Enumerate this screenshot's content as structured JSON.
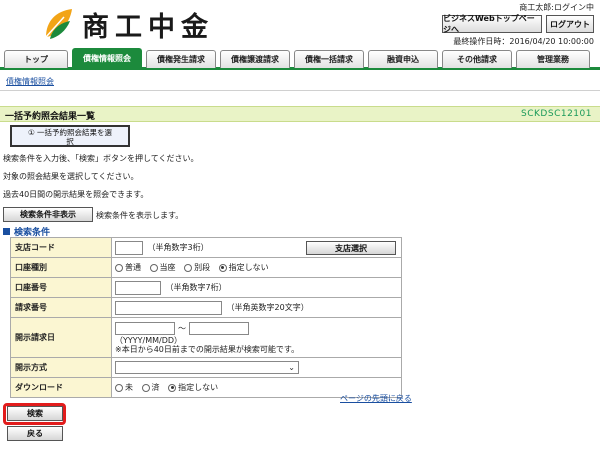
{
  "header": {
    "bank_name": "商工中金",
    "user_status": "商工太郎:ログイン中",
    "web_top_button": "ビジネスWebトップページへ",
    "logout_button": "ログアウト",
    "last_operation": "最終操作日時：2016/04/20 10:00:00"
  },
  "tabs": [
    {
      "label": "トップ"
    },
    {
      "label": "債権情報照会"
    },
    {
      "label": "債権発生請求"
    },
    {
      "label": "債権譲渡請求"
    },
    {
      "label": "債権一括請求"
    },
    {
      "label": "融資申込"
    },
    {
      "label": "その他請求"
    },
    {
      "label": "管理業務"
    }
  ],
  "breadcrumb": "債権情報照会",
  "page": {
    "title": "一括予約照会結果一覧",
    "screen_code": "SCKDSC12101",
    "step_line1": "① 一括予約照会結果を選",
    "step_line2": "択"
  },
  "instructions": [
    "検索条件を入力後、「検索」ボタンを押してください。",
    "対象の照会結果を選択してください。",
    "過去40日間の開示結果を照会できます。"
  ],
  "toggle": {
    "button_label": "検索条件非表示",
    "description": "検索条件を表示します。"
  },
  "section_title": "検索条件",
  "form": {
    "branch_code": {
      "label": "支店コード",
      "hint": "（半角数字3桁）",
      "select_button": "支店選択",
      "value": ""
    },
    "account_type": {
      "label": "口座種別",
      "options": [
        "普通",
        "当座",
        "別段",
        "指定しない"
      ],
      "selected": "指定しない"
    },
    "account_number": {
      "label": "口座番号",
      "hint": "（半角数字7桁）",
      "value": ""
    },
    "request_number": {
      "label": "請求番号",
      "hint": "（半角英数字20文字）",
      "value": ""
    },
    "disclosure_date": {
      "label": "開示請求日",
      "tilde": "〜",
      "format_hint": "（YYYY/MM/DD）",
      "note": "※本日から40日前までの開示結果が検索可能です。",
      "from": "",
      "to": ""
    },
    "disclosure_method": {
      "label": "開示方式",
      "selected": ""
    },
    "download": {
      "label": "ダウンロード",
      "options": [
        "未",
        "済",
        "指定しない"
      ],
      "selected": "指定しない"
    }
  },
  "page_top_link": "ページの先頭に戻る",
  "actions": {
    "search_button": "検索",
    "back_button": "戻る"
  },
  "colors": {
    "brand_green": "#1c8a3c",
    "title_bg": "#e9f3c6",
    "label_bg": "#fbf6d2",
    "link_blue": "#1a4fa0",
    "highlight_red": "#e21c1c"
  }
}
